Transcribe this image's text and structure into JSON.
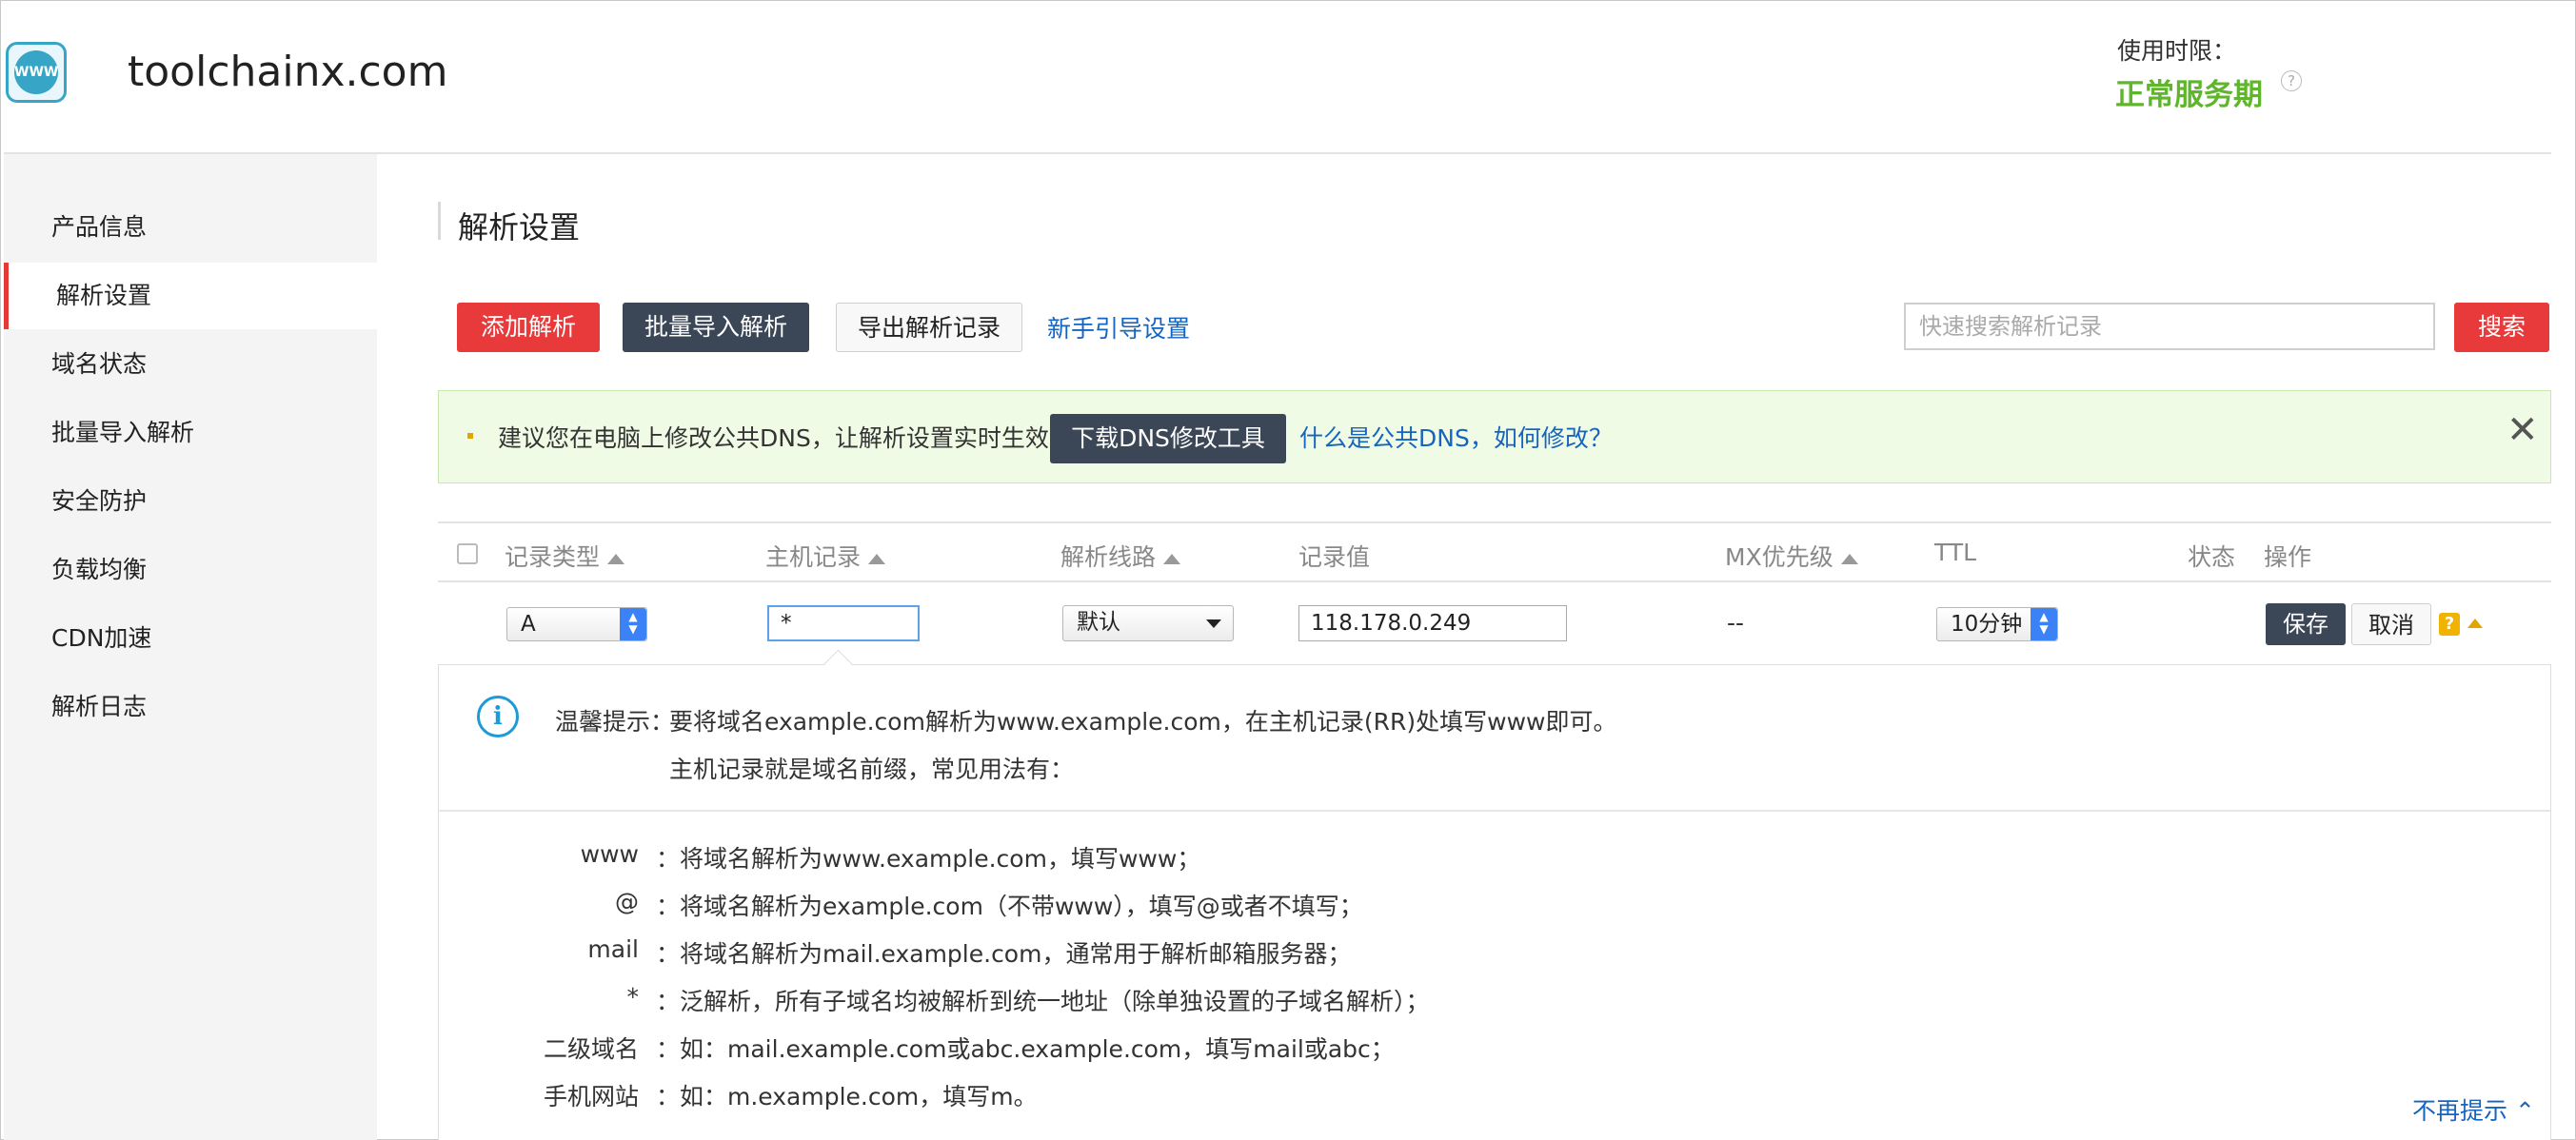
{
  "header": {
    "logo_text": "WWW",
    "site_title": "toolchainx.com",
    "service_period_label": "使用时限：",
    "service_period_value": "正常服务期",
    "help_icon": "?"
  },
  "sidebar": {
    "items": [
      {
        "label": "产品信息"
      },
      {
        "label": "解析设置",
        "active": true
      },
      {
        "label": "域名状态"
      },
      {
        "label": "批量导入解析"
      },
      {
        "label": "安全防护"
      },
      {
        "label": "负载均衡"
      },
      {
        "label": "CDN加速"
      },
      {
        "label": "解析日志"
      }
    ]
  },
  "main": {
    "section_title": "解析设置",
    "toolbar": {
      "add_label": "添加解析",
      "bulk_import_label": "批量导入解析",
      "export_label": "导出解析记录",
      "guide_link": "新手引导设置",
      "search_placeholder": "快速搜索解析记录",
      "search_button": "搜索"
    },
    "notice": {
      "text": "建议您在电脑上修改公共DNS，让解析设置实时生效。",
      "download_button": "下载DNS修改工具",
      "link": "什么是公共DNS，如何修改？",
      "close": "✕"
    },
    "table": {
      "columns": [
        "记录类型",
        "主机记录",
        "解析线路",
        "记录值",
        "MX优先级",
        "TTL",
        "状态",
        "操作"
      ],
      "edit_row": {
        "record_type": "A",
        "host": "*",
        "line": "默认",
        "value": "118.178.0.249",
        "mx": "--",
        "ttl": "10分钟",
        "save_label": "保存",
        "cancel_label": "取消",
        "help": "?"
      }
    },
    "tip": {
      "label": "温馨提示：",
      "line1": "要将域名example.com解析为www.example.com，在主机记录(RR)处填写www即可。",
      "line2": "主机记录就是域名前缀，常见用法有：",
      "examples": [
        {
          "key": "www",
          "value": "：将域名解析为www.example.com，填写www；"
        },
        {
          "key": "@",
          "value": "：将域名解析为example.com（不带www），填写@或者不填写；"
        },
        {
          "key": "mail",
          "value": "：将域名解析为mail.example.com，通常用于解析邮箱服务器；"
        },
        {
          "key": "*",
          "value": "：泛解析，所有子域名均被解析到统一地址（除单独设置的子域名解析）；"
        },
        {
          "key": "二级域名",
          "value": "：如：mail.example.com或abc.example.com，填写mail或abc；"
        },
        {
          "key": "手机网站",
          "value": "：如：m.example.com，填写m。"
        }
      ],
      "no_more_label": "不再提示"
    }
  },
  "colors": {
    "primary_red": "#e83a3a",
    "dark_button": "#3b4656",
    "link_blue": "#1565c0",
    "service_green": "#5fb52b"
  }
}
